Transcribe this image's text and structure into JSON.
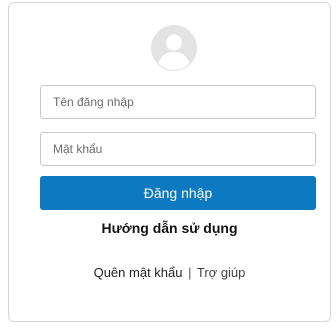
{
  "login": {
    "avatar_icon": "user-avatar-icon",
    "username_placeholder": "Tên đăng nhập",
    "password_placeholder": "Mật khẩu",
    "login_button_label": "Đăng nhập",
    "guide_link": "Hướng dẫn sử dụng",
    "forgot_password_link": "Quên mật khẩu",
    "separator": "|",
    "help_link": "Trợ giúp",
    "colors": {
      "primary_button": "#0c79c0",
      "avatar_gray": "#d9d9d9"
    }
  }
}
